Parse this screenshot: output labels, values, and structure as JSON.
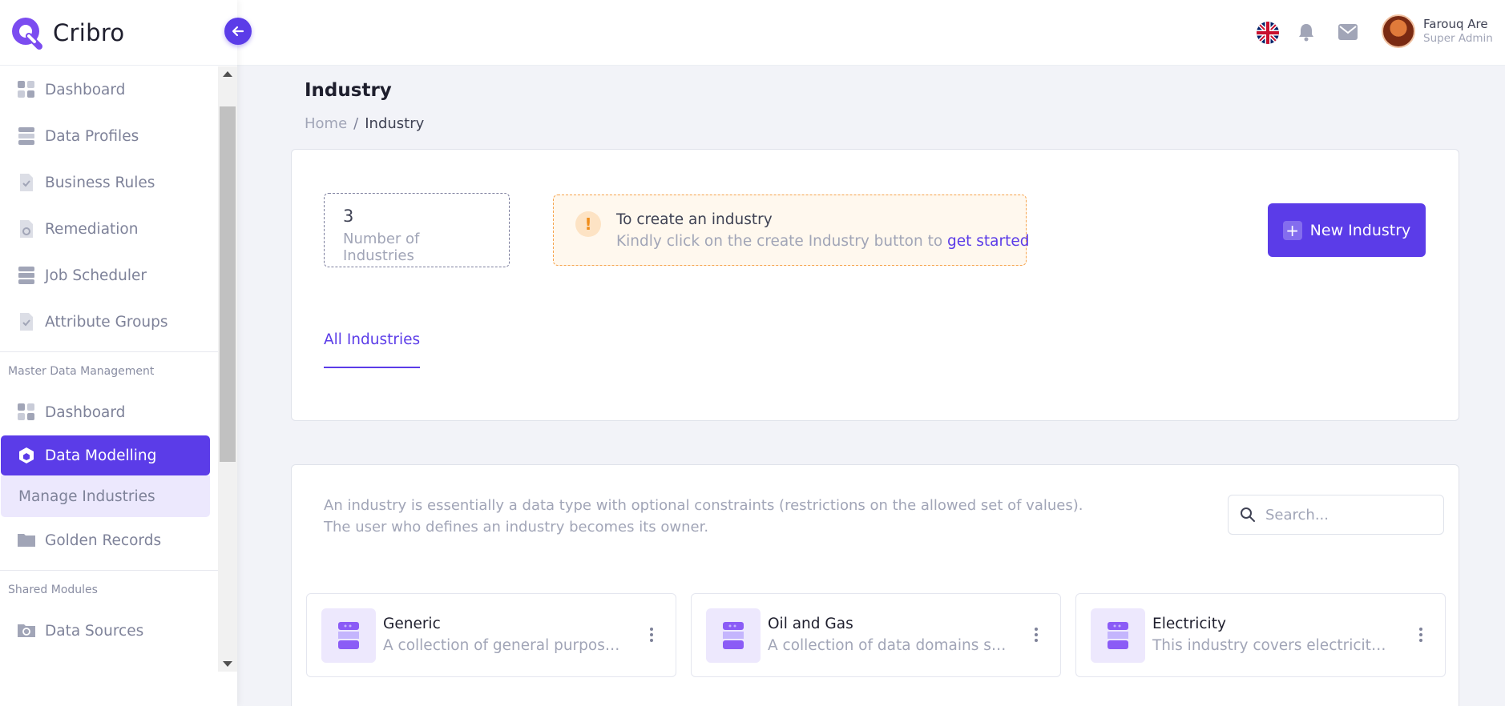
{
  "brand": {
    "name": "Cribro"
  },
  "sidebar": {
    "items": [
      {
        "label": "Dashboard",
        "icon": "grid-icon"
      },
      {
        "label": "Data Profiles",
        "icon": "database-icon"
      },
      {
        "label": "Business Rules",
        "icon": "document-check-icon"
      },
      {
        "label": "Remediation",
        "icon": "document-refresh-icon"
      },
      {
        "label": "Job Scheduler",
        "icon": "database-icon"
      },
      {
        "label": "Attribute Groups",
        "icon": "document-check-icon"
      }
    ],
    "section_mdm": "Master Data Management",
    "mdm_items": [
      {
        "label": "Dashboard",
        "icon": "grid-icon"
      },
      {
        "label": "Data Modelling",
        "icon": "cube-icon"
      },
      {
        "label": "Manage Industries"
      },
      {
        "label": "Golden Records",
        "icon": "folder-icon"
      }
    ],
    "section_shared": "Shared Modules",
    "shared_items": [
      {
        "label": "Data Sources",
        "icon": "refresh-folder-icon"
      }
    ]
  },
  "header": {
    "user_name": "Farouq Are",
    "user_role": "Super Admin"
  },
  "page": {
    "title": "Industry",
    "breadcrumb_home": "Home",
    "breadcrumb_sep": "/",
    "breadcrumb_current": "Industry"
  },
  "stats": {
    "value": "3",
    "label": "Number of Industries"
  },
  "notice": {
    "title": "To create an industry",
    "text": "Kindly click on the create Industry button to ",
    "link": "get started"
  },
  "new_button": {
    "label": "New Industry"
  },
  "tabs": {
    "all": "All Industries"
  },
  "description": {
    "line1": "An industry is essentially a data type with optional constraints (restrictions on the allowed set of values).",
    "line2": "The user who defines an industry becomes its owner."
  },
  "search": {
    "placeholder": "Search..."
  },
  "industries": [
    {
      "name": "Generic",
      "desc": "A collection of general purpose data domains"
    },
    {
      "name": "Oil and Gas",
      "desc": "A collection of data domains specific to oil and gas"
    },
    {
      "name": "Electricity",
      "desc": "This industry covers electricity, gas and utilities"
    }
  ],
  "colors": {
    "accent": "#5b3ce8",
    "notice_bg": "#fff8ee",
    "notice_border": "#f6a34c"
  }
}
